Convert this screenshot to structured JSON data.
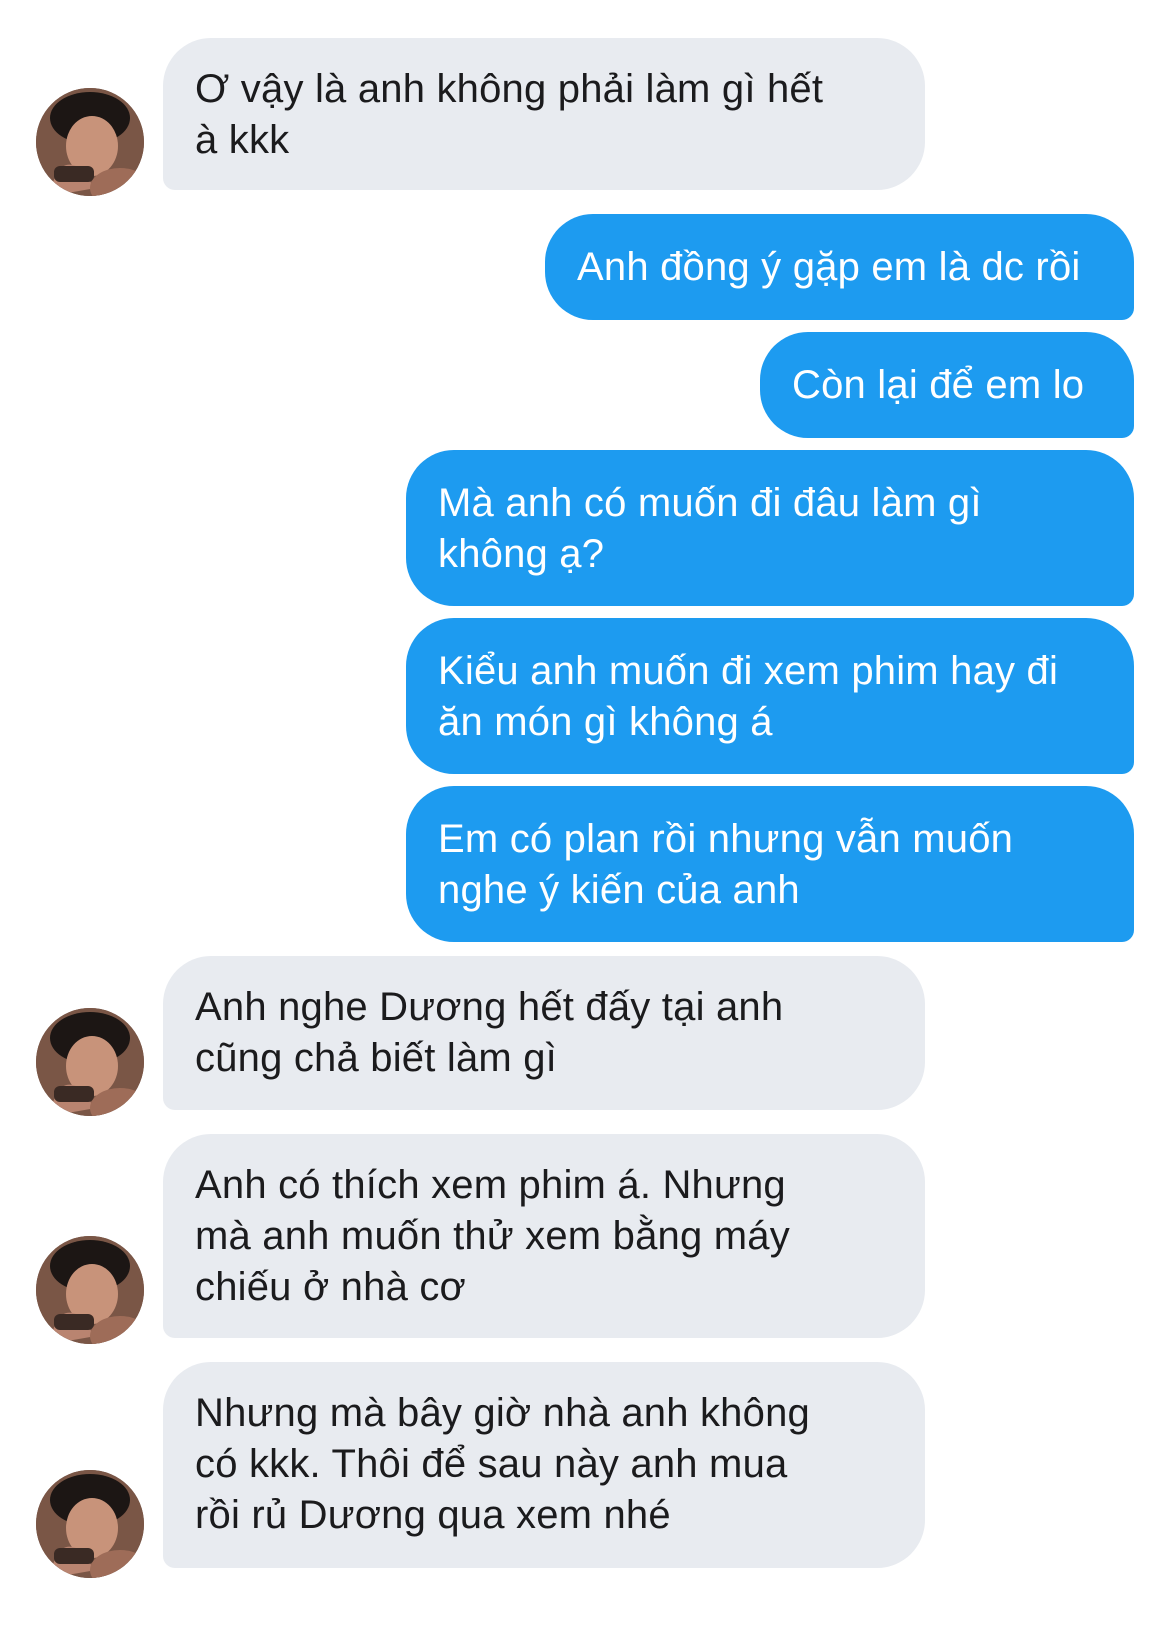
{
  "conversation": {
    "messages": [
      {
        "sender": "contact",
        "text": "Ơ vậy là anh không phải làm gì hết\nà kkk"
      },
      {
        "sender": "me",
        "text": "Anh đồng ý gặp em là dc rồi"
      },
      {
        "sender": "me",
        "text": "Còn lại để em lo"
      },
      {
        "sender": "me",
        "text": "Mà anh có muốn đi đâu làm gì\nkhông ạ?"
      },
      {
        "sender": "me",
        "text": "Kiểu anh muốn đi xem phim hay đi\năn món gì không á"
      },
      {
        "sender": "me",
        "text": "Em có plan rồi nhưng vẫn muốn\nnghe ý kiến của anh"
      },
      {
        "sender": "contact",
        "text": "Anh nghe Dương hết đấy tại anh\ncũng chả biết làm gì"
      },
      {
        "sender": "contact",
        "text": "Anh có thích xem phim á. Nhưng\nmà anh muốn thử xem bằng máy\nchiếu ở nhà cơ"
      },
      {
        "sender": "contact",
        "text": "Nhưng mà bây giờ nhà anh không\ncó kkk. Thôi để sau này anh mua\nrồi rủ Dương qua xem nhé"
      }
    ]
  },
  "colors": {
    "incoming_bubble": "#e8ebf0",
    "outgoing_bubble": "#1d9bf0",
    "incoming_text": "#1b1b1d",
    "outgoing_text": "#ffffff"
  },
  "icons": {
    "contact_avatar": "profile-photo"
  }
}
